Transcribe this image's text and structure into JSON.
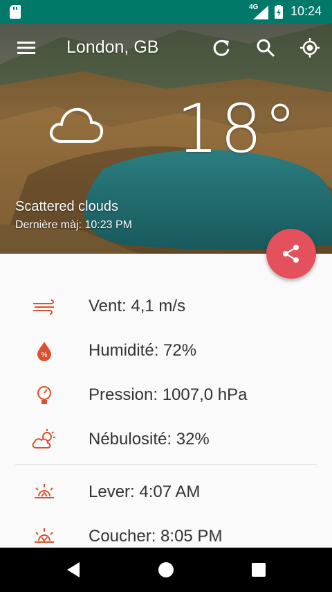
{
  "status_bar": {
    "network": "4G",
    "time": "10:24"
  },
  "header": {
    "city": "London, GB",
    "temperature": "18°",
    "condition": "Scattered clouds",
    "last_update": "Dernière màj: 10:23 PM"
  },
  "details": {
    "wind": "Vent: 4,1 m/s",
    "humidity": "Humidité: 72%",
    "pressure": "Pression: 1007,0 hPa",
    "cloudiness": "Nébulosité: 32%",
    "sunrise": "Lever: 4:07 AM",
    "sunset": "Coucher: 8:05 PM"
  },
  "colors": {
    "status_bar": "#00796b",
    "accent": "#e4505c",
    "icon": "#d9522b"
  }
}
